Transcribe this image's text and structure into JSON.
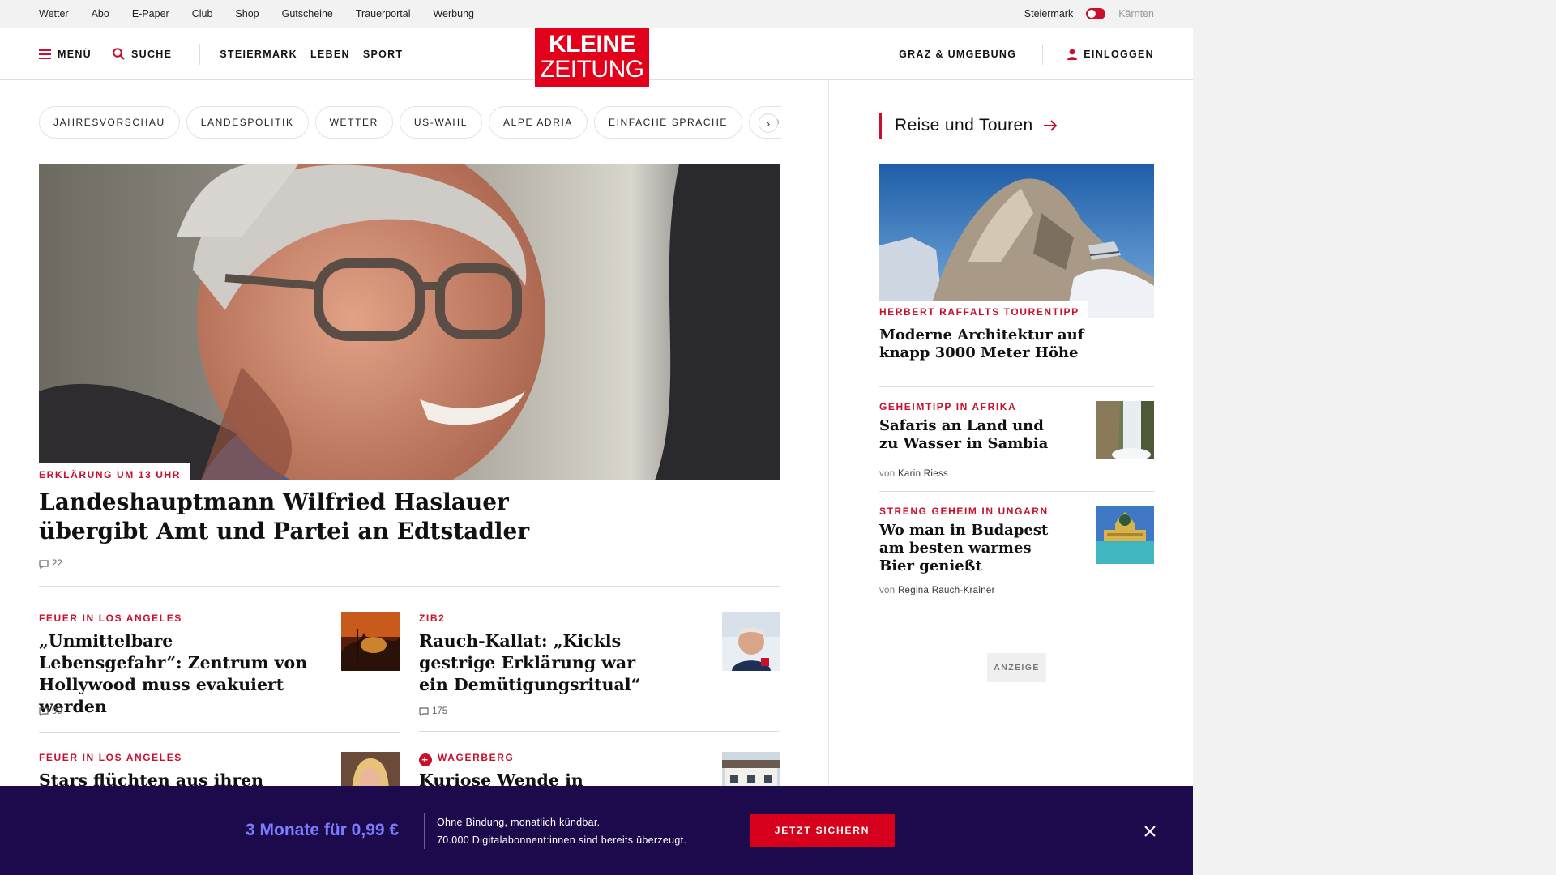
{
  "topbar": {
    "links": [
      "Wetter",
      "Abo",
      "E-Paper",
      "Club",
      "Shop",
      "Gutscheine",
      "Trauerportal",
      "Werbung"
    ],
    "region_active": "Steiermark",
    "region_other": "Kärnten"
  },
  "header": {
    "menu_label": "MENÜ",
    "search_label": "SUCHE",
    "nav": [
      "STEIERMARK",
      "LEBEN",
      "SPORT"
    ],
    "logo_line1": "KLEINE",
    "logo_line2": "ZEITUNG",
    "local_label": "GRAZ & UMGEBUNG",
    "login_label": "EINLOGGEN",
    "brand_color": "#e2001a"
  },
  "pills": [
    "JAHRESVORSCHAU",
    "LANDESPOLITIK",
    "WETTER",
    "US-WAHL",
    "ALPE ADRIA",
    "EINFACHE SPRACHE",
    "DOS"
  ],
  "hero": {
    "kicker": "ERKLÄRUNG UM 13 UHR",
    "title": "Landeshauptmann Wilfried Haslauer übergibt Amt und Partei an Edtstadler",
    "comments": "22"
  },
  "articles": [
    {
      "kicker": "FEUER IN LOS ANGELES",
      "title": "„Unmittelbare Lebensgefahr“: Zentrum von Hollywood muss evakuiert werden",
      "comments": "99"
    },
    {
      "kicker": "ZIB2",
      "title": "Rauch-Kallat: „Kickls gestrige Erklärung war ein Demütigungsritual“",
      "comments": "175"
    },
    {
      "kicker": "FEUER IN LOS ANGELES",
      "title": "Stars flüchten aus ihren"
    },
    {
      "kicker": "WAGERBERG",
      "title": "Kuriose Wende in Baustellen-"
    }
  ],
  "sidebar": {
    "section_title": "Reise und Touren",
    "hero": {
      "kicker": "HERBERT RAFFALTS TOURENTIPP",
      "title": "Moderne Architektur auf knapp 3000 Meter Höhe"
    },
    "items": [
      {
        "kicker": "GEHEIMTIPP IN AFRIKA",
        "title": "Safaris an Land und zu Wasser in Sambia",
        "author_prefix": "von",
        "author": "Karin Riess"
      },
      {
        "kicker": "STRENG GEHEIM IN UNGARN",
        "title": "Wo man in Budapest am besten warmes Bier genießt",
        "author_prefix": "von",
        "author": "Regina Rauch-Krainer"
      }
    ],
    "ad_label": "ANZEIGE"
  },
  "promo": {
    "offer": "3 Monate für 0,99 €",
    "line1": "Ohne Bindung, monatlich kündbar.",
    "line2": "70.000 Digitalabonnent:innen sind bereits überzeugt.",
    "cta": "JETZT SICHERN",
    "background": "#1c0a4d",
    "accent": "#7a7cff"
  }
}
